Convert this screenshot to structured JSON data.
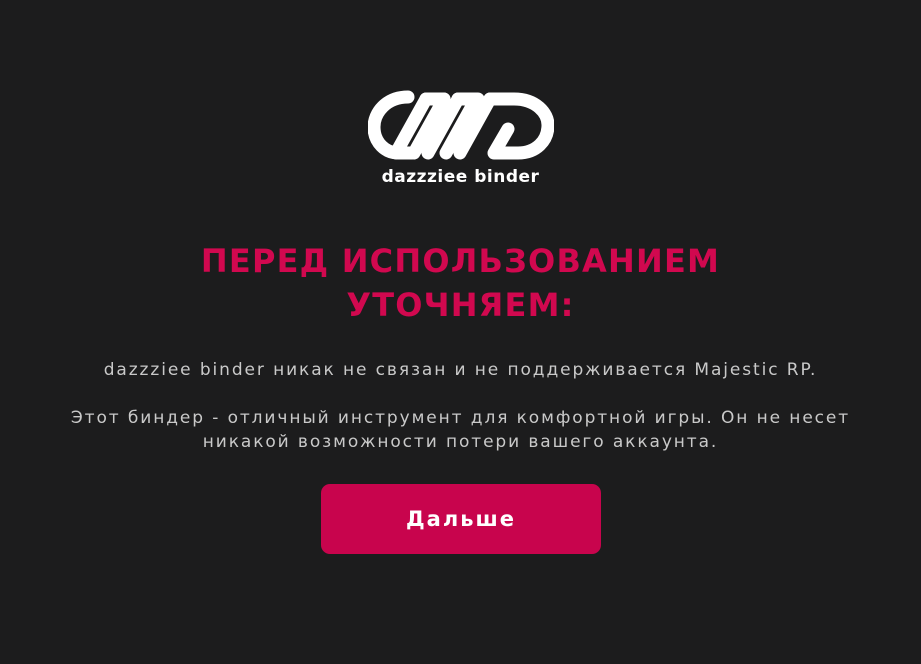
{
  "app": {
    "name": "dazzziee binder",
    "logo_icon": "infinity-links-logo-icon"
  },
  "notice": {
    "headline_lines": [
      "ПЕРЕД ИСПОЛЬЗОВАНИЕМ",
      "УТОЧНЯЕМ:"
    ],
    "disclaimer": "dazzziee binder никак не связан и не поддерживается Majestic RP.",
    "info_lines": [
      "Этот биндер - отличный инструмент для комфортной игры. Он не несет",
      "никакой возможности потери вашего аккаунта."
    ]
  },
  "actions": {
    "next_label": "Дальше"
  },
  "colors": {
    "background": "#1c1c1d",
    "accent": "#c8044d",
    "headline": "#d1084f",
    "body_text": "#c9c9c9"
  }
}
